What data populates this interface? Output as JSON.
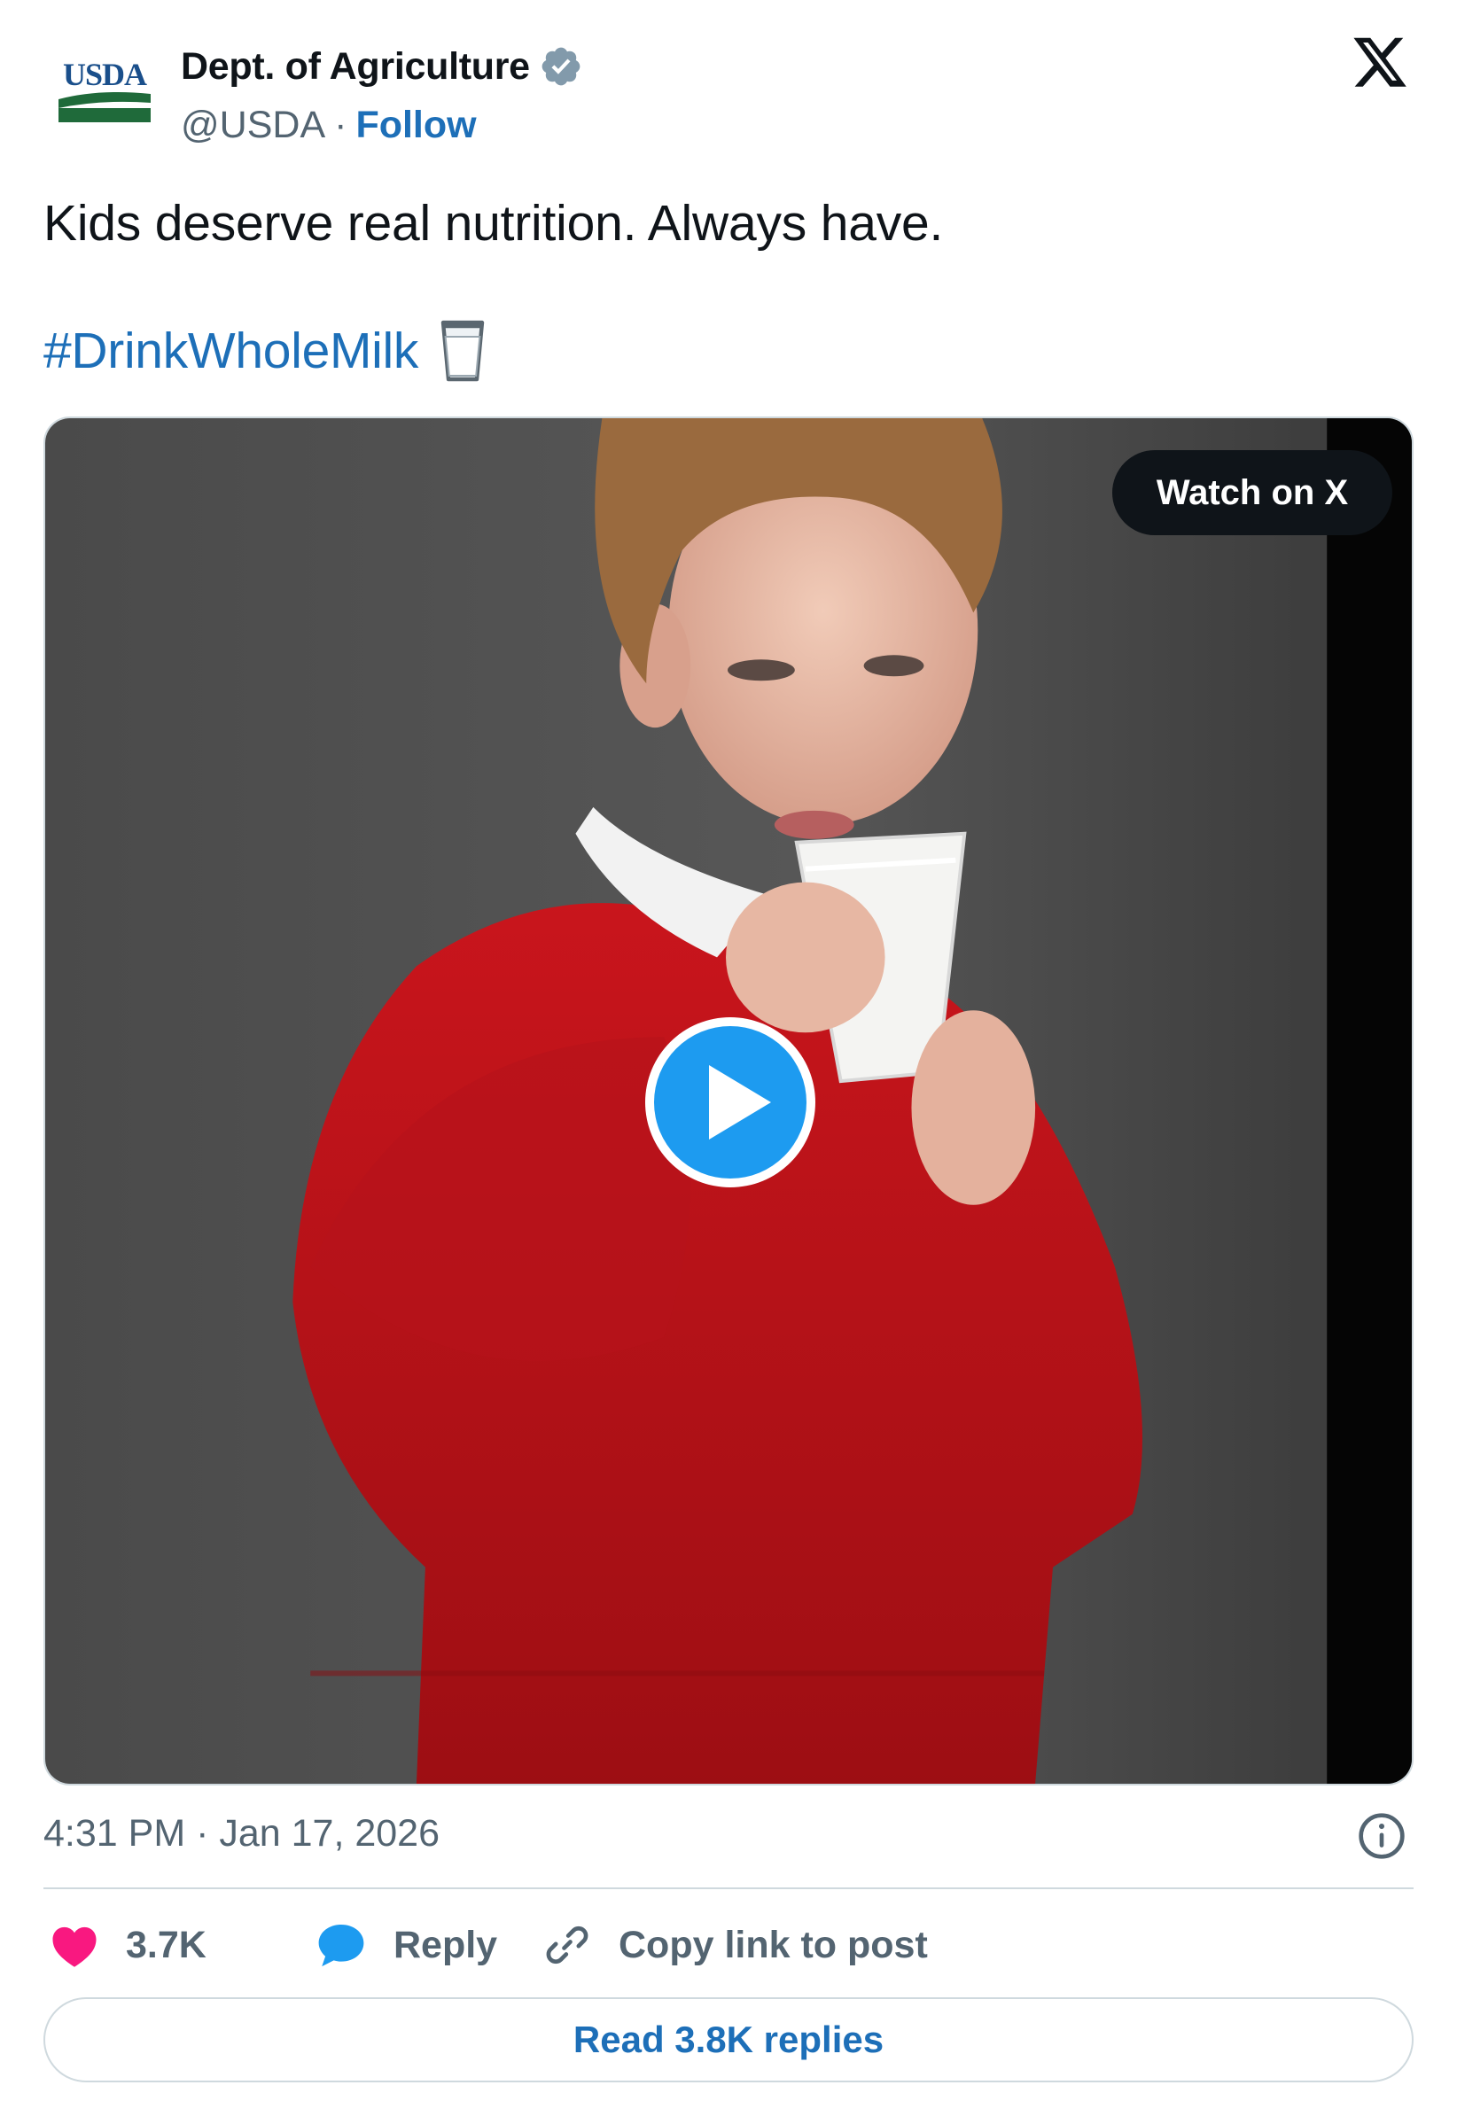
{
  "author": {
    "logo_text": "USDA",
    "display_name": "Dept. of Agriculture",
    "handle": "@USDA",
    "separator": "·",
    "follow_label": "Follow",
    "verified_icon": "verified-badge-icon"
  },
  "post": {
    "text": "Kids deserve real nutrition. Always have.",
    "hashtag": "#DrinkWholeMilk",
    "emoji_icon": "milk-glass-icon"
  },
  "media": {
    "type": "video",
    "watch_label": "Watch on X",
    "play_icon": "play-icon"
  },
  "meta": {
    "timestamp": "4:31 PM · Jan 17, 2026",
    "info_icon": "info-icon"
  },
  "actions": {
    "like_count": "3.7K",
    "reply_label": "Reply",
    "copy_label": "Copy link to post"
  },
  "read_replies_label": "Read 3.8K replies",
  "colors": {
    "link_blue": "#1d6fb8",
    "like_pink": "#f91880",
    "play_blue": "#1d9bf0",
    "muted_gray": "#536471",
    "sweater_red": "#c4161c"
  }
}
